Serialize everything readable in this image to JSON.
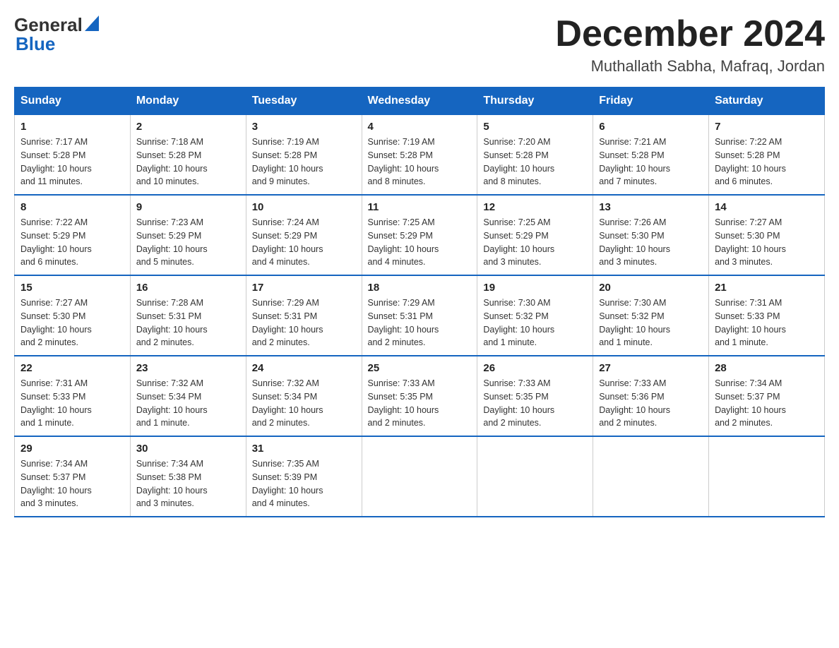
{
  "header": {
    "logo_general": "General",
    "logo_blue": "Blue",
    "month": "December 2024",
    "location": "Muthallath Sabha, Mafraq, Jordan"
  },
  "days_of_week": [
    "Sunday",
    "Monday",
    "Tuesday",
    "Wednesday",
    "Thursday",
    "Friday",
    "Saturday"
  ],
  "weeks": [
    [
      {
        "day": "1",
        "info": "Sunrise: 7:17 AM\nSunset: 5:28 PM\nDaylight: 10 hours\nand 11 minutes."
      },
      {
        "day": "2",
        "info": "Sunrise: 7:18 AM\nSunset: 5:28 PM\nDaylight: 10 hours\nand 10 minutes."
      },
      {
        "day": "3",
        "info": "Sunrise: 7:19 AM\nSunset: 5:28 PM\nDaylight: 10 hours\nand 9 minutes."
      },
      {
        "day": "4",
        "info": "Sunrise: 7:19 AM\nSunset: 5:28 PM\nDaylight: 10 hours\nand 8 minutes."
      },
      {
        "day": "5",
        "info": "Sunrise: 7:20 AM\nSunset: 5:28 PM\nDaylight: 10 hours\nand 8 minutes."
      },
      {
        "day": "6",
        "info": "Sunrise: 7:21 AM\nSunset: 5:28 PM\nDaylight: 10 hours\nand 7 minutes."
      },
      {
        "day": "7",
        "info": "Sunrise: 7:22 AM\nSunset: 5:28 PM\nDaylight: 10 hours\nand 6 minutes."
      }
    ],
    [
      {
        "day": "8",
        "info": "Sunrise: 7:22 AM\nSunset: 5:29 PM\nDaylight: 10 hours\nand 6 minutes."
      },
      {
        "day": "9",
        "info": "Sunrise: 7:23 AM\nSunset: 5:29 PM\nDaylight: 10 hours\nand 5 minutes."
      },
      {
        "day": "10",
        "info": "Sunrise: 7:24 AM\nSunset: 5:29 PM\nDaylight: 10 hours\nand 4 minutes."
      },
      {
        "day": "11",
        "info": "Sunrise: 7:25 AM\nSunset: 5:29 PM\nDaylight: 10 hours\nand 4 minutes."
      },
      {
        "day": "12",
        "info": "Sunrise: 7:25 AM\nSunset: 5:29 PM\nDaylight: 10 hours\nand 3 minutes."
      },
      {
        "day": "13",
        "info": "Sunrise: 7:26 AM\nSunset: 5:30 PM\nDaylight: 10 hours\nand 3 minutes."
      },
      {
        "day": "14",
        "info": "Sunrise: 7:27 AM\nSunset: 5:30 PM\nDaylight: 10 hours\nand 3 minutes."
      }
    ],
    [
      {
        "day": "15",
        "info": "Sunrise: 7:27 AM\nSunset: 5:30 PM\nDaylight: 10 hours\nand 2 minutes."
      },
      {
        "day": "16",
        "info": "Sunrise: 7:28 AM\nSunset: 5:31 PM\nDaylight: 10 hours\nand 2 minutes."
      },
      {
        "day": "17",
        "info": "Sunrise: 7:29 AM\nSunset: 5:31 PM\nDaylight: 10 hours\nand 2 minutes."
      },
      {
        "day": "18",
        "info": "Sunrise: 7:29 AM\nSunset: 5:31 PM\nDaylight: 10 hours\nand 2 minutes."
      },
      {
        "day": "19",
        "info": "Sunrise: 7:30 AM\nSunset: 5:32 PM\nDaylight: 10 hours\nand 1 minute."
      },
      {
        "day": "20",
        "info": "Sunrise: 7:30 AM\nSunset: 5:32 PM\nDaylight: 10 hours\nand 1 minute."
      },
      {
        "day": "21",
        "info": "Sunrise: 7:31 AM\nSunset: 5:33 PM\nDaylight: 10 hours\nand 1 minute."
      }
    ],
    [
      {
        "day": "22",
        "info": "Sunrise: 7:31 AM\nSunset: 5:33 PM\nDaylight: 10 hours\nand 1 minute."
      },
      {
        "day": "23",
        "info": "Sunrise: 7:32 AM\nSunset: 5:34 PM\nDaylight: 10 hours\nand 1 minute."
      },
      {
        "day": "24",
        "info": "Sunrise: 7:32 AM\nSunset: 5:34 PM\nDaylight: 10 hours\nand 2 minutes."
      },
      {
        "day": "25",
        "info": "Sunrise: 7:33 AM\nSunset: 5:35 PM\nDaylight: 10 hours\nand 2 minutes."
      },
      {
        "day": "26",
        "info": "Sunrise: 7:33 AM\nSunset: 5:35 PM\nDaylight: 10 hours\nand 2 minutes."
      },
      {
        "day": "27",
        "info": "Sunrise: 7:33 AM\nSunset: 5:36 PM\nDaylight: 10 hours\nand 2 minutes."
      },
      {
        "day": "28",
        "info": "Sunrise: 7:34 AM\nSunset: 5:37 PM\nDaylight: 10 hours\nand 2 minutes."
      }
    ],
    [
      {
        "day": "29",
        "info": "Sunrise: 7:34 AM\nSunset: 5:37 PM\nDaylight: 10 hours\nand 3 minutes."
      },
      {
        "day": "30",
        "info": "Sunrise: 7:34 AM\nSunset: 5:38 PM\nDaylight: 10 hours\nand 3 minutes."
      },
      {
        "day": "31",
        "info": "Sunrise: 7:35 AM\nSunset: 5:39 PM\nDaylight: 10 hours\nand 4 minutes."
      },
      {
        "day": "",
        "info": ""
      },
      {
        "day": "",
        "info": ""
      },
      {
        "day": "",
        "info": ""
      },
      {
        "day": "",
        "info": ""
      }
    ]
  ]
}
